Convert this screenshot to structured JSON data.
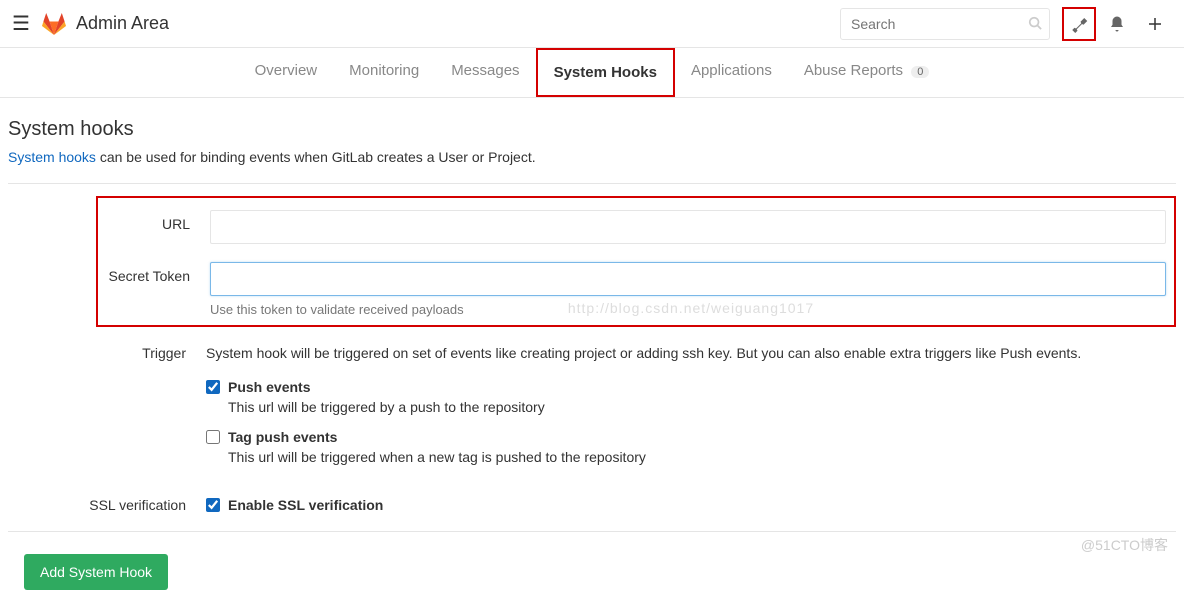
{
  "header": {
    "title": "Admin Area",
    "search_placeholder": "Search"
  },
  "tabs": [
    {
      "label": "Overview"
    },
    {
      "label": "Monitoring"
    },
    {
      "label": "Messages"
    },
    {
      "label": "System Hooks"
    },
    {
      "label": "Applications"
    },
    {
      "label": "Abuse Reports",
      "badge": "0"
    }
  ],
  "page": {
    "title": "System hooks",
    "link_text": "System hooks",
    "desc_suffix": " can be used for binding events when GitLab creates a User or Project."
  },
  "form": {
    "url_label": "URL",
    "url_value": "",
    "token_label": "Secret Token",
    "token_value": "",
    "token_help": "Use this token to validate received payloads"
  },
  "trigger": {
    "label": "Trigger",
    "desc": "System hook will be triggered on set of events like creating project or adding ssh key. But you can also enable extra triggers like Push events.",
    "push": {
      "label": "Push events",
      "desc": "This url will be triggered by a push to the repository",
      "checked": true
    },
    "tag": {
      "label": "Tag push events",
      "desc": "This url will be triggered when a new tag is pushed to the repository",
      "checked": false
    }
  },
  "ssl": {
    "label": "SSL verification",
    "check_label": "Enable SSL verification",
    "checked": true
  },
  "submit_label": "Add System Hook",
  "watermark_corner": "@51CTO博客",
  "watermark_center": "http://blog.csdn.net/weiguang1017"
}
